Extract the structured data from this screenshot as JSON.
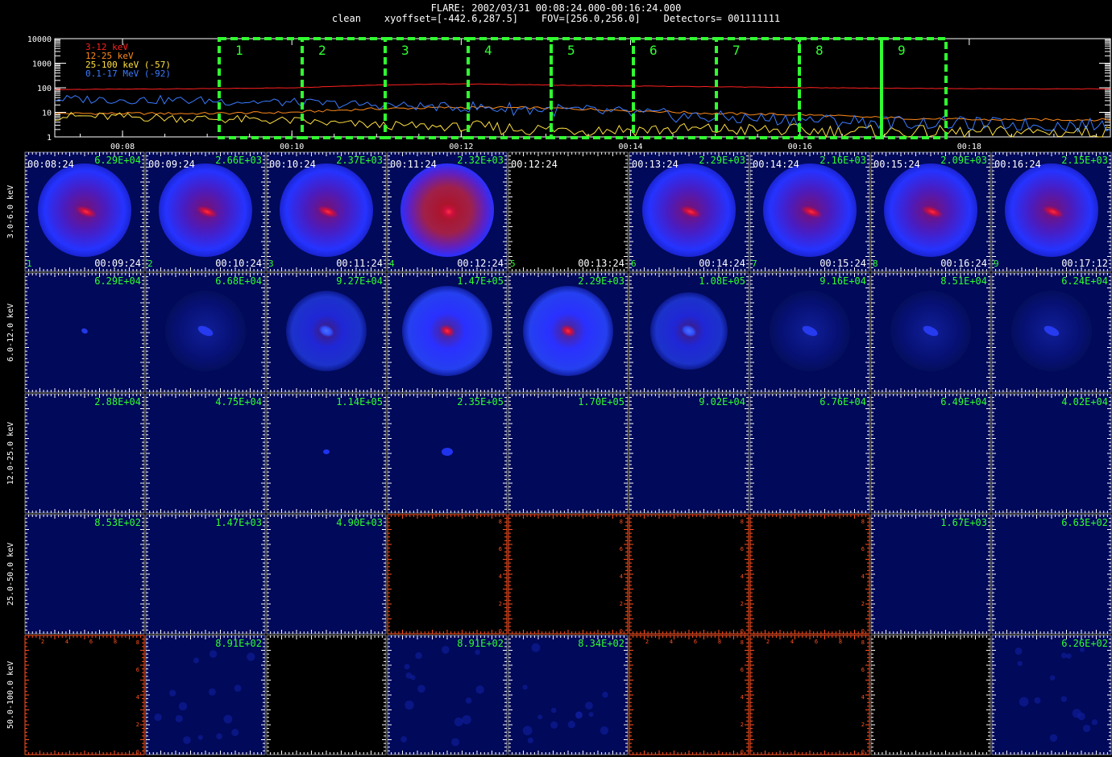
{
  "header": {
    "line1": "FLARE: 2002/03/31 00:08:24.000-00:16:24.000",
    "line2": "clean    xyoffset=[-442.6,287.5]    FOV=[256.0,256.0]    Detectors= 001111111"
  },
  "chart_data": [
    {
      "type": "line",
      "yscale": "log",
      "ylim": [
        1,
        10000
      ],
      "yticks": [
        "10000",
        "1000",
        "100",
        "10",
        "1"
      ],
      "xlim": [
        "00:07:12",
        "00:19:40"
      ],
      "xticks": [
        "00:08",
        "00:10",
        "00:12",
        "00:14",
        "00:16",
        "00:18"
      ],
      "legend_position": "top-left",
      "series": [
        {
          "name": "3-12 keV",
          "color": "#ff2020",
          "x_minutes": [
            7.2,
            8,
            9,
            10,
            10.5,
            11,
            12,
            13,
            14,
            15,
            16,
            17,
            18,
            19,
            19.67
          ],
          "values": [
            85,
            88,
            92,
            100,
            115,
            130,
            145,
            130,
            118,
            110,
            102,
            96,
            92,
            90,
            90
          ]
        },
        {
          "name": "12-25 keV",
          "color": "#ff8a1a",
          "x_minutes": [
            7.2,
            8,
            9,
            10,
            10.5,
            11,
            12,
            13,
            14,
            15,
            16,
            17,
            18,
            19,
            19.67
          ],
          "values": [
            9,
            9,
            9,
            10,
            12,
            14,
            16,
            15,
            12,
            9,
            8,
            6,
            5,
            5,
            5
          ]
        },
        {
          "name": "25-100 keV (-57)",
          "color": "#ffe040",
          "x_minutes": [
            7.2,
            8,
            9,
            10,
            10.5,
            11,
            12,
            13,
            14,
            15,
            16,
            17,
            18,
            19,
            19.67
          ],
          "values": [
            7,
            6.5,
            5.5,
            4.5,
            3.5,
            3,
            2.5,
            2,
            2,
            2,
            1.8,
            1.6,
            1.5,
            1.6,
            1.5
          ]
        },
        {
          "name": "0.1-17 MeV (-92)",
          "color": "#3a7bff",
          "x_minutes": [
            7.2,
            8,
            9,
            10,
            10.5,
            11,
            12,
            13,
            14,
            15,
            16,
            17,
            18,
            19,
            19.67
          ],
          "values": [
            35,
            33,
            30,
            25,
            22,
            20,
            16,
            13,
            9,
            6,
            5,
            4,
            3.5,
            3,
            3
          ]
        }
      ],
      "intervals": [
        {
          "label": "1"
        },
        {
          "label": "2"
        },
        {
          "label": "3"
        },
        {
          "label": "4"
        },
        {
          "label": "5"
        },
        {
          "label": "6"
        },
        {
          "label": "7"
        },
        {
          "label": "8"
        },
        {
          "label": "9"
        }
      ]
    },
    {
      "type": "image_grid",
      "row_labels": [
        "3.0-6.0 keV",
        "6.0-12.0 keV",
        "12.0-25.0 keV",
        "25.0-50.0 keV",
        "50.0-100.0 keV"
      ],
      "start_times": [
        "00:08:24",
        "00:09:24",
        "00:10:24",
        "00:11:24",
        "00:12:24",
        "00:13:24",
        "00:14:24",
        "00:15:24",
        "00:16:24"
      ],
      "end_times": [
        "00:09:24",
        "00:10:24",
        "00:11:24",
        "00:12:24",
        "00:13:24",
        "00:14:24",
        "00:15:24",
        "00:16:24",
        "00:17:12"
      ],
      "interval_numbers": [
        "1",
        "2",
        "3",
        "4",
        "5",
        "6",
        "7",
        "8",
        "9"
      ],
      "peaks": [
        [
          "6.29E+04",
          "2.66E+03",
          "2.37E+03",
          "2.32E+03",
          "",
          "2.29E+03",
          "2.16E+03",
          "2.09E+03",
          "2.15E+03"
        ],
        [
          "6.29E+04",
          "6.68E+04",
          "9.27E+04",
          "1.47E+05",
          "2.29E+03",
          "1.08E+05",
          "9.16E+04",
          "8.51E+04",
          "6.24E+04"
        ],
        [
          "2.88E+04",
          "4.75E+04",
          "1.14E+05",
          "2.35E+05",
          "1.70E+05",
          "9.02E+04",
          "6.76E+04",
          "6.49E+04",
          "4.02E+04"
        ],
        [
          "8.53E+02",
          "1.47E+03",
          "4.90E+03",
          "",
          "",
          "",
          "",
          "1.67E+03",
          "6.63E+02"
        ],
        [
          "",
          "8.91E+02",
          "",
          "8.91E+02",
          "8.34E+02",
          "",
          "",
          "",
          "6.26E+02"
        ]
      ],
      "cell_kind": [
        [
          "full",
          "full",
          "full",
          "full",
          "empty",
          "full",
          "full",
          "full",
          "full"
        ],
        [
          "faint",
          "faint",
          "disk",
          "disk",
          "disk",
          "disk",
          "faint",
          "faint",
          "faint"
        ],
        [
          "plain",
          "plain",
          "plain",
          "plain",
          "plain",
          "plain",
          "plain",
          "plain",
          "plain"
        ],
        [
          "plain",
          "plain",
          "plain",
          "axes",
          "axes",
          "axes",
          "axes",
          "plain",
          "plain"
        ],
        [
          "axes",
          "noise",
          "empty",
          "noise",
          "noise",
          "axes",
          "axes",
          "empty",
          "noise"
        ]
      ],
      "colors": {
        "green": "#30ff30",
        "axis_orange": "#ff5020",
        "dark_blue": "#000a55"
      }
    }
  ]
}
